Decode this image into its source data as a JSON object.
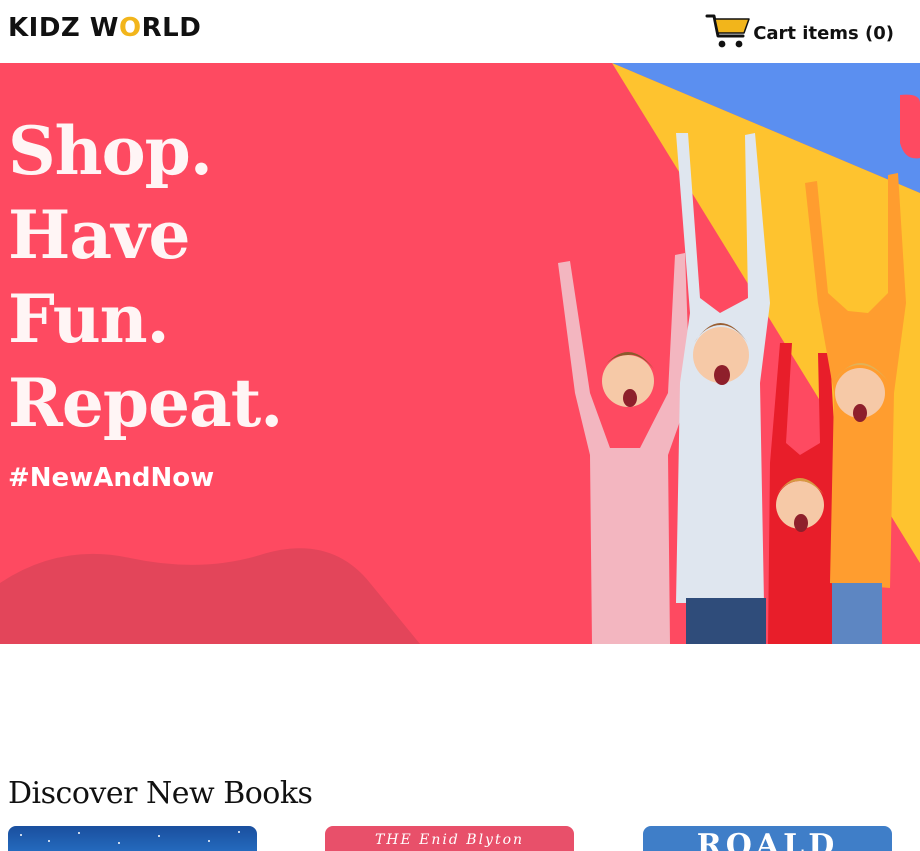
{
  "header": {
    "logo_left": "KIDZ W",
    "logo_o": "O",
    "logo_right": "RLD",
    "cart_label": "Cart items (0)",
    "cart_icon": "shopping-cart-icon"
  },
  "hero": {
    "lines": [
      "Shop.",
      "Have",
      "Fun.",
      "Repeat."
    ],
    "hashtag": "#NewAndNow",
    "image": "excited-children-cheering"
  },
  "section": {
    "title": "Discover New Books"
  },
  "books": [
    {
      "cover_text": "",
      "cover_color": "#1a4f9e"
    },
    {
      "cover_text": "THE Enid Blyton",
      "cover_color": "#e8506a"
    },
    {
      "cover_text": "ROALD",
      "cover_color": "#3f7ec8"
    }
  ],
  "colors": {
    "hero_bg": "#fe4a61",
    "accent_yellow": "#f2b51b",
    "accent_blue": "#5b8ff0"
  }
}
